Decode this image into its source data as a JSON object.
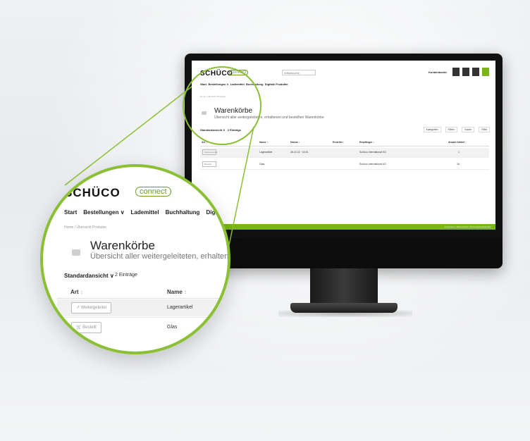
{
  "app": {
    "brand": "SCHÜCO",
    "brand_sub": "connect",
    "search_placeholder": "Artikelsuche",
    "user_label": "Kundenkonto",
    "nav": [
      "Start",
      "Bestellungen ∨",
      "Lademittel",
      "Buchhaltung",
      "Digitale Produkte"
    ],
    "breadcrumb": "Home / Übersicht Produkte",
    "page_title": "Warenkörbe",
    "page_subtitle": "Übersicht aller weitergeleiteten, erhaltenen und bestellten Warenkörbe",
    "page_subtitle_zoom": "Übersicht aller weitergeleiteten, erhaltenen u",
    "view_label": "Standardansicht ∨",
    "count_label": "2 Einträge",
    "toolbar": [
      "Kategorien",
      "Filtern",
      "Suche",
      "Filter"
    ],
    "columns": [
      "Art ↕",
      "Name ↕",
      "Datum ↕",
      "Ersteller ↕",
      "Empfänger ↕",
      "Anzahl Artikel ↕"
    ],
    "column_art": "Art",
    "column_name": "Name",
    "sort_glyph": "↕",
    "rows": [
      {
        "type": "Weitergeleitet",
        "name": "Lagerartikel",
        "date": "26.10.22 · 15:41",
        "creator": "",
        "recipient": "Schüco International KG",
        "count": "1"
      },
      {
        "type": "Bestellt",
        "name": "Glas",
        "date": "",
        "creator": "",
        "recipient": "Schüco International KG",
        "count": "16"
      }
    ],
    "footer": "Impressum | Datenschutz | Nutzungsbedingungen"
  },
  "colors": {
    "accent": "#7ab51d",
    "ring": "#8bc034",
    "monitor": "#111111"
  }
}
